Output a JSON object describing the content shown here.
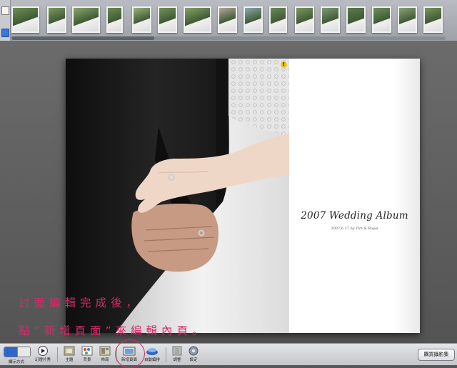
{
  "filmstrip": {
    "thumbnails": [
      {
        "name": "photo-thumb-1",
        "tone": "#6f8f52"
      },
      {
        "name": "photo-thumb-2",
        "tone": "#7d9a5f"
      },
      {
        "name": "photo-thumb-3",
        "tone": "#8aa66a"
      },
      {
        "name": "photo-thumb-4",
        "tone": "#6b8a54"
      },
      {
        "name": "photo-thumb-5",
        "tone": "#9cb07a"
      },
      {
        "name": "photo-thumb-6",
        "tone": "#72905a"
      },
      {
        "name": "photo-thumb-7",
        "tone": "#85a368"
      },
      {
        "name": "photo-thumb-8",
        "tone": "#b6a79a"
      },
      {
        "name": "photo-thumb-9",
        "tone": "#8fa7b4"
      },
      {
        "name": "photo-thumb-10",
        "tone": "#6a8c55"
      },
      {
        "name": "photo-thumb-11",
        "tone": "#7c9864"
      },
      {
        "name": "photo-thumb-12",
        "tone": "#7f9a79"
      },
      {
        "name": "photo-thumb-13",
        "tone": "#5d7a4a"
      },
      {
        "name": "photo-thumb-14",
        "tone": "#6f8e5d"
      },
      {
        "name": "photo-thumb-15",
        "tone": "#8aa276"
      },
      {
        "name": "photo-thumb-16",
        "tone": "#7b945e"
      }
    ]
  },
  "album": {
    "title": "2007 Wedding Album",
    "subtitle": "2007.6.17 by Tim & Royal",
    "warning_icon": "!"
  },
  "annotation": {
    "line1": "封面編輯完成後，",
    "line2": "點”新增頁面”來編輯內頁。"
  },
  "toolbar": {
    "view_label": "顯示方式",
    "slideshow_label": "幻燈片秀",
    "theme_label": "主題",
    "background_label": "背景",
    "layout_label": "佈局",
    "add_page_label": "新增頁面",
    "autoflow_label": "自動編排",
    "adjust_label": "調整",
    "settings_label": "設定",
    "buy_label": "購買攝影集"
  },
  "colors": {
    "annotation": "#d42a6a",
    "canvas": "#575757",
    "toolbar": "#d6d8db"
  }
}
